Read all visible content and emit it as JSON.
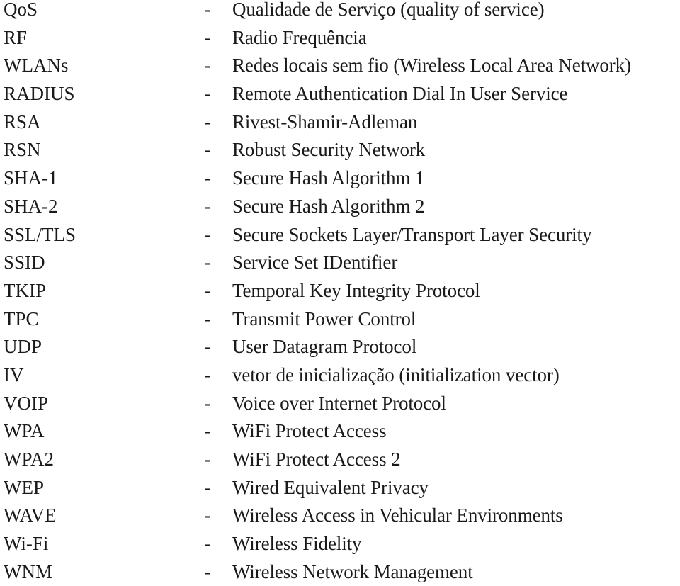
{
  "glossary": {
    "separator": "-",
    "entries": [
      {
        "abbr": "QoS",
        "definition": "Qualidade de Serviço (quality of service)"
      },
      {
        "abbr": "RF",
        "definition": "Radio Frequência"
      },
      {
        "abbr": "WLANs",
        "definition": "Redes locais sem fio (Wireless Local Area Network)"
      },
      {
        "abbr": "RADIUS",
        "definition": "Remote Authentication Dial In User Service"
      },
      {
        "abbr": "RSA",
        "definition": "Rivest-Shamir-Adleman"
      },
      {
        "abbr": "RSN",
        "definition": "Robust Security Network"
      },
      {
        "abbr": "SHA-1",
        "definition": "Secure Hash Algorithm 1"
      },
      {
        "abbr": "SHA-2",
        "definition": "Secure Hash Algorithm 2"
      },
      {
        "abbr": "SSL/TLS",
        "definition": "Secure Sockets Layer/Transport Layer Security"
      },
      {
        "abbr": "SSID",
        "definition": "Service Set IDentifier"
      },
      {
        "abbr": "TKIP",
        "definition": "Temporal Key Integrity Protocol"
      },
      {
        "abbr": "TPC",
        "definition": "Transmit Power Control"
      },
      {
        "abbr": "UDP",
        "definition": "User Datagram Protocol"
      },
      {
        "abbr": "IV",
        "definition": "vetor de inicialização (initialization vector)"
      },
      {
        "abbr": "VOIP",
        "definition": "Voice over Internet Protocol"
      },
      {
        "abbr": "WPA",
        "definition": "WiFi Protect Access"
      },
      {
        "abbr": "WPA2",
        "definition": "WiFi Protect Access 2"
      },
      {
        "abbr": "WEP",
        "definition": "Wired Equivalent Privacy"
      },
      {
        "abbr": "WAVE",
        "definition": "Wireless Access in Vehicular Environments"
      },
      {
        "abbr": "Wi-Fi",
        "definition": "Wireless Fidelity"
      },
      {
        "abbr": "WNM",
        "definition": "Wireless Network Management"
      }
    ]
  }
}
